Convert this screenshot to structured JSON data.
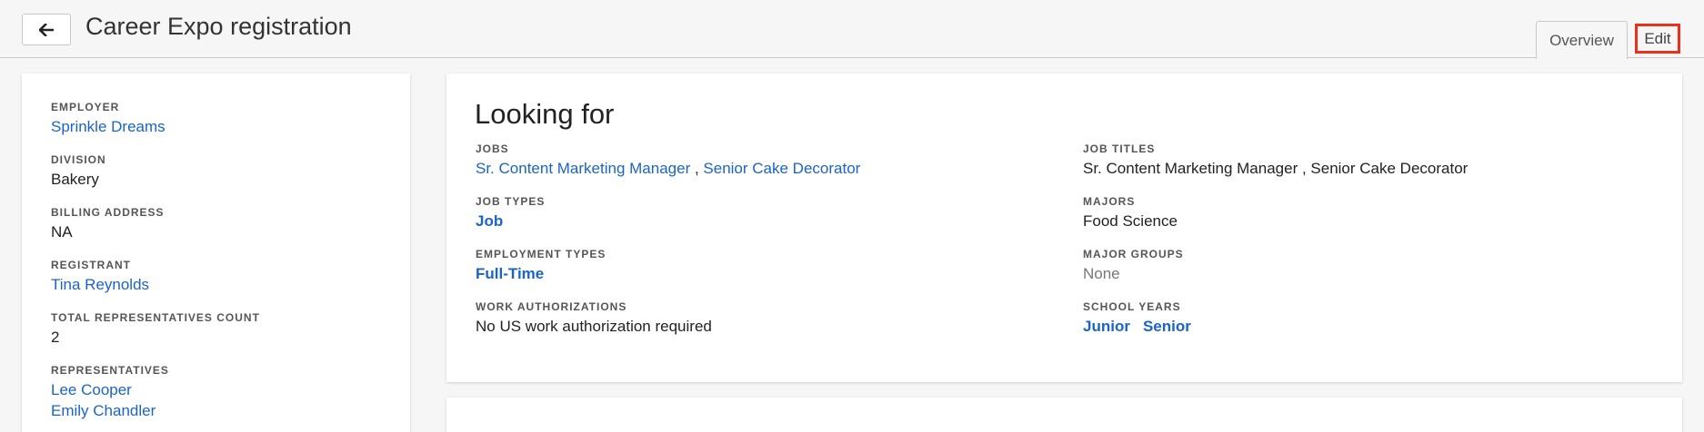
{
  "header": {
    "title": "Career Expo registration",
    "back_icon": "arrow-left-icon",
    "tabs": [
      {
        "label": "Overview"
      },
      {
        "label": "Edit"
      }
    ]
  },
  "left_panel": {
    "fields": [
      {
        "label": "EMPLOYER",
        "value": "Sprinkle Dreams"
      },
      {
        "label": "DIVISION",
        "value": "Bakery"
      },
      {
        "label": "BILLING ADDRESS",
        "value": "NA"
      },
      {
        "label": "REGISTRANT",
        "value": "Tina Reynolds"
      },
      {
        "label": "TOTAL REPRESENTATIVES COUNT",
        "value": "2"
      },
      {
        "label": "REPRESENTATIVES",
        "values": [
          "Lee Cooper",
          "Emily Chandler"
        ]
      }
    ]
  },
  "looking_for": {
    "title": "Looking for",
    "jobs": {
      "label": "JOBS",
      "values": [
        "Sr. Content Marketing Manager",
        "Senior Cake Decorator"
      ],
      "separator": " , "
    },
    "job_types": {
      "label": "JOB TYPES",
      "value": "Job"
    },
    "employment_types": {
      "label": "EMPLOYMENT TYPES",
      "value": "Full-Time"
    },
    "work_authorizations": {
      "label": "WORK AUTHORIZATIONS",
      "value": "No US work authorization required"
    },
    "job_titles": {
      "label": "JOB TITLES",
      "value": "Sr. Content Marketing Manager , Senior Cake Decorator"
    },
    "majors": {
      "label": "MAJORS",
      "value": "Food Science"
    },
    "major_groups": {
      "label": "MAJOR GROUPS",
      "value": "None"
    },
    "school_years": {
      "label": "SCHOOL YEARS",
      "values": [
        "Junior",
        "Senior"
      ]
    }
  },
  "colors": {
    "link": "#1a64c8",
    "highlight": "#e8301c",
    "background": "#f6f6f6"
  }
}
